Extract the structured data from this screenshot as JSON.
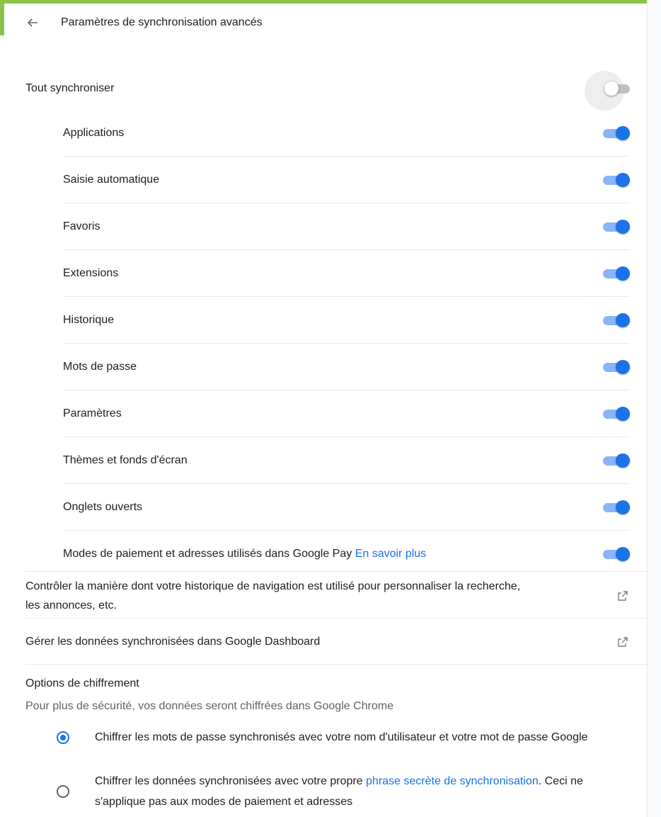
{
  "header": {
    "title": "Paramètres de synchronisation avancés"
  },
  "sync_all": {
    "label": "Tout synchroniser",
    "enabled": false
  },
  "sync_items": [
    {
      "label": "Applications",
      "enabled": true
    },
    {
      "label": "Saisie automatique",
      "enabled": true
    },
    {
      "label": "Favoris",
      "enabled": true
    },
    {
      "label": "Extensions",
      "enabled": true
    },
    {
      "label": "Historique",
      "enabled": true
    },
    {
      "label": "Mots de passe",
      "enabled": true
    },
    {
      "label": "Paramètres",
      "enabled": true
    },
    {
      "label": "Thèmes et fonds d'écran",
      "enabled": true
    },
    {
      "label": "Onglets ouverts",
      "enabled": true
    },
    {
      "label": "Modes de paiement et adresses utilisés dans Google Pay",
      "link": "En savoir plus",
      "enabled": true
    }
  ],
  "links": {
    "history_control": "Contrôler la manière dont votre historique de navigation est utilisé pour personnaliser la recherche, les annonces, etc.",
    "dashboard": "Gérer les données synchronisées dans Google Dashboard"
  },
  "encryption": {
    "title": "Options de chiffrement",
    "subtitle": "Pour plus de sécurité, vos données seront chiffrées dans Google Chrome",
    "option1": "Chiffrer les mots de passe synchronisés avec votre nom d'utilisateur et votre mot de passe Google",
    "option2_prefix": "Chiffrer les données synchronisées avec votre propre ",
    "option2_link": "phrase secrète de synchronisation",
    "option2_suffix": ". Ceci ne s'applique pas aux modes de paiement et adresses"
  },
  "colors": {
    "accent": "#1a73e8",
    "accent_track": "#8ab4f8",
    "top_bar": "#8bc34a"
  },
  "icons": {
    "back": "arrow-left-icon",
    "external": "open-in-new-icon"
  }
}
